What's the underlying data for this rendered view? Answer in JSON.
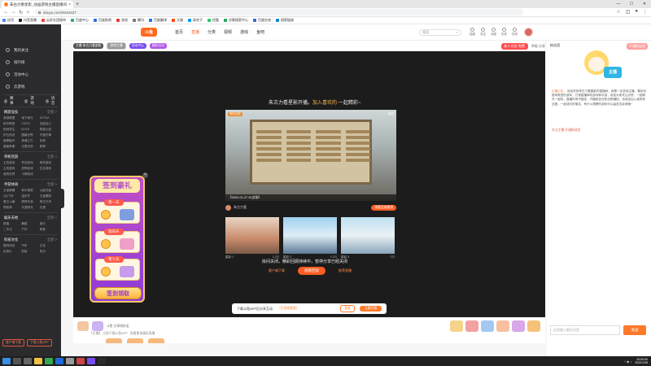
{
  "browser": {
    "tab_title": "朱古力看星影_动画游戏主播直播间",
    "new_tab": "+",
    "url": "douyu.com/9194427",
    "bookmarks": [
      "应用",
      "抖音直播",
      "云轩社团接待",
      "百度中心",
      "百度贴吧",
      "游戏",
      "腾讯",
      "百度翻译",
      "天猫",
      "高宅子",
      "优酷",
      "谷歌搜索中心",
      "百度在线",
      "搜索链接"
    ]
  },
  "sidebar": {
    "links": [
      "我的关注",
      "排行榜",
      "活动中心",
      "云游戏"
    ],
    "nav_row": [
      "赛事",
      "游戏",
      "语音"
    ],
    "categories": [
      {
        "title": "网游竞技",
        "more": "全部 >",
        "items": [
          "英雄联盟",
          "地下城与",
          "DOTA2",
          "和平精英",
          "CSGO",
          "全能战士",
          "绝地求生",
          "DOTA",
          "穿越火线",
          "炉石传说",
          "魔兽世界",
          "守望先锋",
          "暗黑破坏",
          "英魂之刃",
          "传奇",
          "魔兽争霸",
          "无限法则",
          "原神"
        ]
      },
      {
        "title": "单机热游",
        "more": "全部 >",
        "items": [
          "主机游戏",
          "怀旧游戏",
          "单机游戏",
          "主机游戏",
          "恐怖游戏",
          "生存游戏",
          "我的世界",
          "卡牌游戏"
        ]
      },
      {
        "title": "手游休闲",
        "more": "全部 >",
        "items": [
          "王者荣耀",
          "和平精英",
          "火影忍者",
          "QQ飞车",
          "金铲铲",
          "王者模拟",
          "第五人格",
          "原神手游",
          "明日方舟",
          "阴阳师",
          "天涯明月",
          "光遇"
        ]
      },
      {
        "title": "娱乐天地",
        "more": "全部 >",
        "items": [
          "颜值",
          "舞蹈",
          "音乐",
          "二次元",
          "户外",
          "美食"
        ]
      },
      {
        "title": "科技文化",
        "more": "全部 >",
        "items": [
          "数码科技",
          "汽车",
          "文化",
          "纪录片",
          "财经",
          "知识"
        ]
      }
    ],
    "bottom": [
      "客户端下载",
      "下载斗鱼APP"
    ]
  },
  "header": {
    "logo": "斗鱼",
    "nav": [
      "首页",
      "直播",
      "分类",
      "视频",
      "游戏",
      "鱼吧"
    ],
    "active_nav": "直播",
    "search_placeholder": "搜索",
    "icons": [
      "抽奖",
      "关注",
      "消息",
      "历史",
      "任务"
    ]
  },
  "room": {
    "tags": [
      "主播 朱古力看星影",
      "游戏主播",
      "活动中心",
      "精彩活动"
    ],
    "task_button": "新人任务·免费",
    "meta": "举报  分享"
  },
  "player": {
    "promo_prefix": "朱古力看星影开播。",
    "promo_highlight": "加入喜欢的·",
    "promo_suffix": "一起精彩~",
    "card_badge": "精彩回放",
    "card_corner": "回放",
    "card_caption": "【2022-01-27 20点场】",
    "streamer": "朱古力看",
    "watch_button": "观看回放视频",
    "thumbnails": [
      {
        "title": "星影·1",
        "count": "1.2万"
      },
      {
        "title": "星影·2",
        "count": "1.1万"
      },
      {
        "title": "星影·3",
        "count": "2万"
      }
    ],
    "offline_text": "房间关闭，精彩回顾持续中，暂停分享已经关闭",
    "offline_links": [
      "客户端下载",
      "观看回放",
      "推荐直播"
    ]
  },
  "signin": {
    "title": "签到豪礼",
    "days": [
      "第一天",
      "第四天",
      "第七天"
    ],
    "claim": "签到领取",
    "close": "×"
  },
  "loginbar": {
    "text": "下载斗鱼APP后分享互动",
    "sub": "（已完成登录）",
    "login": "登录",
    "register": "立即注册"
  },
  "giftbar": {
    "left_text": "斗鱼 分享给好友",
    "bottom_text": "【主播】 立即下载斗鱼APP · 观看更多精彩直播"
  },
  "rightpanel": {
    "head_left": "粉丝团",
    "fans_button": "开通粉丝团",
    "intro_label": "主播公告：",
    "intro": "欢迎来到朱古力看星影的直播间，我是一名游戏主播，喜欢玩各种类型的游戏，日常直播单机游戏和手游，欢迎大家关注点赞，一起聊天一起玩，直播时间不固定，开播前会在粉丝群通知，也欢迎加入我的粉丝团，一起成为好朋友，有什么想看的游戏可以留言告诉我哦~",
    "follow": "关注主播 开通粉丝团",
    "chat_placeholder": "这里输入聊天内容",
    "send": "发送"
  },
  "taskbar": {
    "time": "20:00:00",
    "date": "2022/1/28"
  },
  "colors": {
    "accent": "#ff5d23",
    "sidebar_bg": "#2b2b2e",
    "player_bg": "#1c1c1c"
  }
}
